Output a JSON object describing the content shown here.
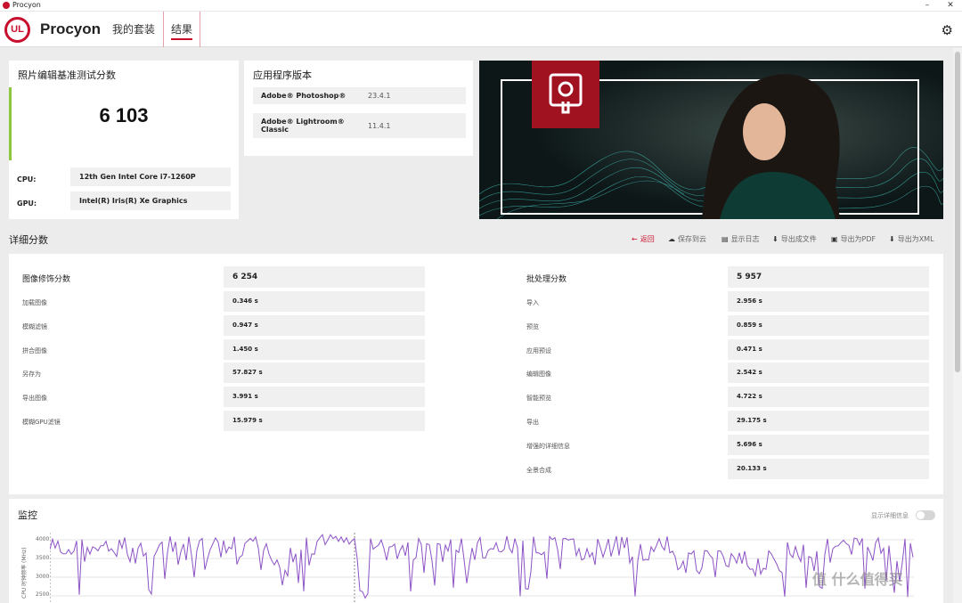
{
  "window": {
    "title": "Procyon"
  },
  "nav": {
    "logo_text": "UL",
    "brand": "Procyon",
    "tabs": [
      {
        "label": "我的套装",
        "active": false
      },
      {
        "label": "结果",
        "active": true
      }
    ]
  },
  "score": {
    "title": "照片编辑基准测试分数",
    "value": "6 103",
    "cpu_label": "CPU:",
    "cpu_value": "12th Gen Intel Core i7-1260P",
    "gpu_label": "GPU:",
    "gpu_value": "Intel(R) Iris(R) Xe Graphics"
  },
  "versions": {
    "title": "应用程序版本",
    "items": [
      {
        "name": "Adobe® Photoshop®",
        "version": "23.4.1"
      },
      {
        "name": "Adobe® Lightroom® Classic",
        "version": "11.4.1"
      }
    ]
  },
  "details": {
    "title": "详细分数",
    "actions": [
      {
        "label": "返回",
        "icon": "back-arrow-icon"
      },
      {
        "label": "保存到云",
        "icon": "cloud-icon"
      },
      {
        "label": "显示日志",
        "icon": "document-icon"
      },
      {
        "label": "导出成文件",
        "icon": "download-icon"
      },
      {
        "label": "导出为PDF",
        "icon": "save-icon"
      },
      {
        "label": "导出为XML",
        "icon": "download-icon"
      }
    ],
    "left": {
      "head_label": "图像修饰分数",
      "head_value": "6 254",
      "rows": [
        {
          "label": "加载图像",
          "value": "0.346 s"
        },
        {
          "label": "模糊滤镜",
          "value": "0.947 s"
        },
        {
          "label": "拼合图像",
          "value": "1.450 s"
        },
        {
          "label": "另存为",
          "value": "57.827 s"
        },
        {
          "label": "导出图像",
          "value": "3.991 s"
        },
        {
          "label": "模糊GPU滤镜",
          "value": "15.979 s"
        }
      ]
    },
    "right": {
      "head_label": "批处理分数",
      "head_value": "5 957",
      "rows": [
        {
          "label": "导入",
          "value": "2.956 s"
        },
        {
          "label": "预览",
          "value": "0.859 s"
        },
        {
          "label": "应用预设",
          "value": "0.471 s"
        },
        {
          "label": "编辑图像",
          "value": "2.542 s"
        },
        {
          "label": "智能预览",
          "value": "4.722 s"
        },
        {
          "label": "导出",
          "value": "29.175 s"
        },
        {
          "label": "增强的详细信息",
          "value": "5.696 s"
        },
        {
          "label": "全景合成",
          "value": "20.133 s"
        }
      ]
    }
  },
  "monitoring": {
    "title": "监控",
    "toggle_label": "显示详细信息",
    "y_axis_label": "CPU 时钟频率 (MHz)",
    "ticks": [
      "4000",
      "3500",
      "3000",
      "2500"
    ]
  },
  "watermark": "值 什么值得买",
  "colors": {
    "accent": "#c8102e",
    "score_bar": "#8cc63f",
    "monitor_line": "#8c52c6"
  }
}
